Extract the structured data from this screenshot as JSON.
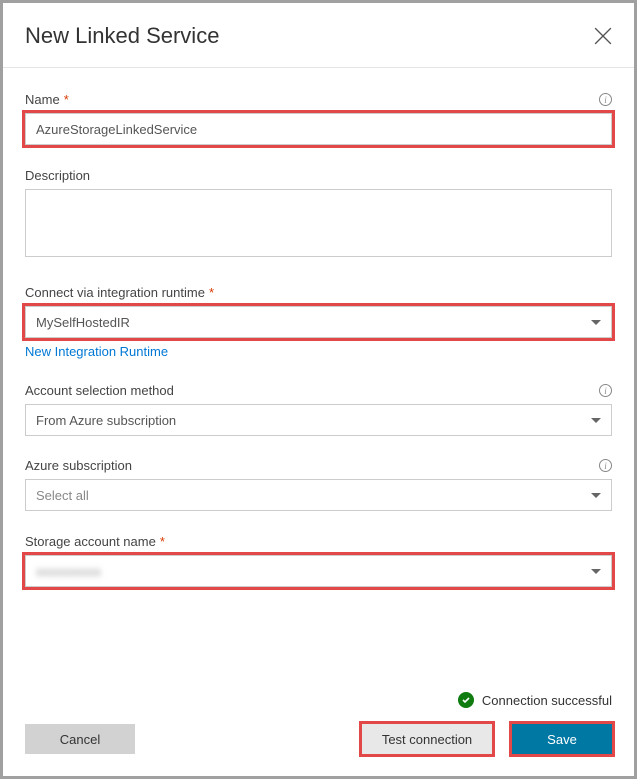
{
  "header": {
    "title": "New Linked Service"
  },
  "fields": {
    "name": {
      "label": "Name",
      "value": "AzureStorageLinkedService"
    },
    "description": {
      "label": "Description",
      "value": ""
    },
    "runtime": {
      "label": "Connect via integration runtime",
      "value": "MySelfHostedIR",
      "newLink": "New Integration Runtime"
    },
    "accountMethod": {
      "label": "Account selection method",
      "value": "From Azure subscription"
    },
    "subscription": {
      "label": "Azure subscription",
      "value": "Select all"
    },
    "storageAccount": {
      "label": "Storage account name",
      "value": "xxxxxxxxxx"
    }
  },
  "status": {
    "message": "Connection successful"
  },
  "footer": {
    "cancel": "Cancel",
    "test": "Test connection",
    "save": "Save"
  }
}
